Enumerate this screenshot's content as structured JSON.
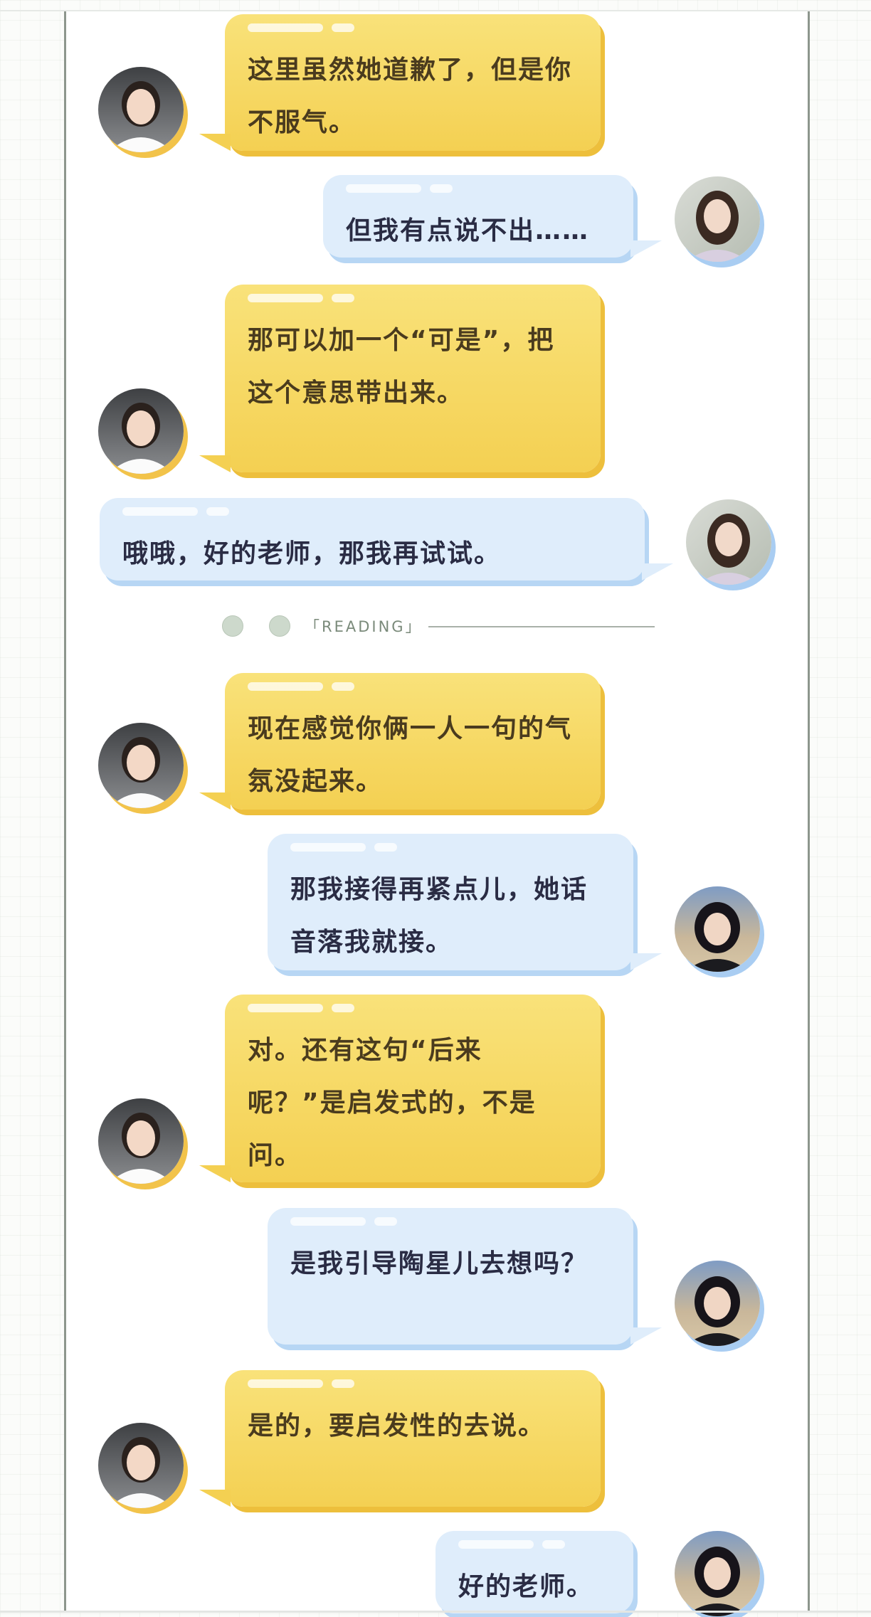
{
  "conversation": {
    "section_label": "「READING」",
    "messages": [
      {
        "speaker": "teacher",
        "text": "这里虽然她道歉了，但是你不服气。"
      },
      {
        "speaker": "student-a",
        "text": "但我有点说不出……"
      },
      {
        "speaker": "teacher",
        "text": "那可以加一个“可是”，把这个意思带出来。"
      },
      {
        "speaker": "student-a",
        "text": "哦哦，好的老师，那我再试试。"
      },
      {
        "speaker": "teacher",
        "text": "现在感觉你俩一人一句的气氛没起来。"
      },
      {
        "speaker": "student-b",
        "text": "那我接得再紧点儿，她话音落我就接。"
      },
      {
        "speaker": "teacher",
        "text": "对。还有这句“后来呢？”是启发式的，不是问。"
      },
      {
        "speaker": "student-b",
        "text": "是我引导陶星儿去想吗？"
      },
      {
        "speaker": "teacher",
        "text": "是的，要启发性的去说。"
      },
      {
        "speaker": "student-b",
        "text": "好的老师。"
      }
    ]
  },
  "colors": {
    "teacher_bubble": "#f6d45c",
    "teacher_bubble_shadow": "#edbf3c",
    "student_bubble": "#dfedfb",
    "student_bubble_shadow": "#b7d6f4",
    "page_border": "#8d968d"
  },
  "icons": {
    "teacher_avatar": "teacher-avatar-icon",
    "student_a_avatar": "student-a-avatar-icon",
    "student_b_avatar": "student-b-avatar-icon"
  }
}
